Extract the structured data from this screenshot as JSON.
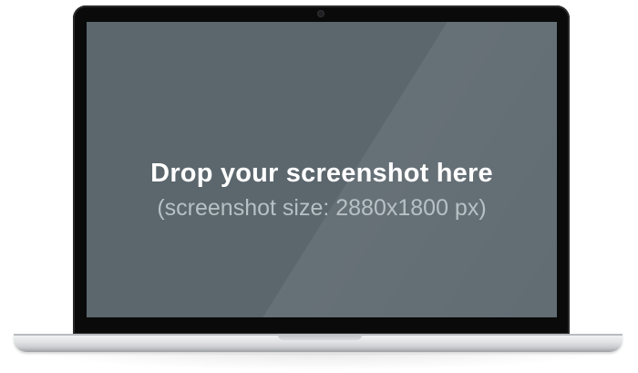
{
  "screen": {
    "headline": "Drop your screenshot here",
    "subline": "(screenshot size: 2880x1800 px)"
  },
  "colors": {
    "screen_bg": "#5b666d",
    "bezel": "#0a0a0a",
    "headline_text": "#ffffff",
    "subline_text": "#b7c0c5"
  }
}
